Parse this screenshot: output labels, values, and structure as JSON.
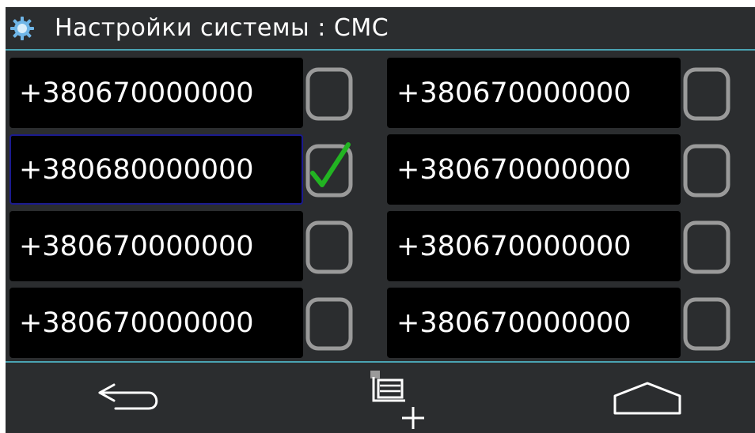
{
  "header": {
    "icon": "gear-icon",
    "title": "Настройки системы : СМС"
  },
  "colors": {
    "background": "#2b2d2f",
    "divider": "#4aa3b3",
    "field": "#000000",
    "checkmark": "#22b422",
    "checkbox_border": "#9a9a9a",
    "focus_border": "#1b1b8f"
  },
  "entries": [
    {
      "number": "+380670000000",
      "checked": false
    },
    {
      "number": "+380670000000",
      "checked": false
    },
    {
      "number": "+380680000000",
      "checked": true
    },
    {
      "number": "+380670000000",
      "checked": false
    },
    {
      "number": "+380670000000",
      "checked": false
    },
    {
      "number": "+380670000000",
      "checked": false
    },
    {
      "number": "+380670000000",
      "checked": false
    },
    {
      "number": "+380670000000",
      "checked": false
    }
  ],
  "footer": {
    "buttons": [
      {
        "icon": "back-arrow-icon"
      },
      {
        "icon": "add-list-icon"
      },
      {
        "icon": "home-icon"
      }
    ]
  }
}
